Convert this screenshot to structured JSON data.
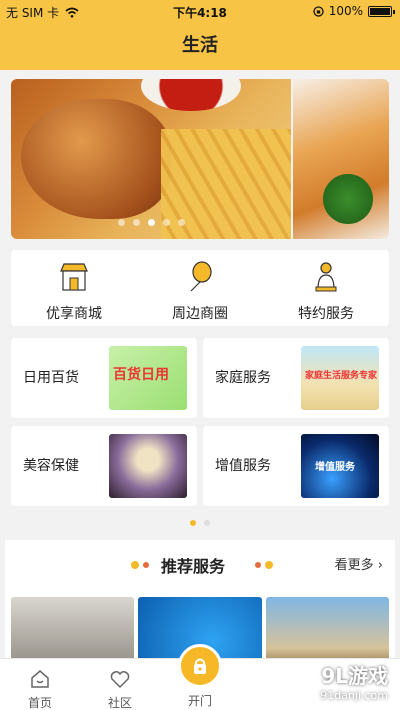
{
  "status_bar": {
    "carrier": "无 SIM 卡",
    "time": "下午4:18",
    "battery": "100%"
  },
  "nav": {
    "title": "生活"
  },
  "banner": {
    "slides": 5,
    "active_slide": 2
  },
  "categories": [
    {
      "label": "优享商城",
      "icon": "shop-icon"
    },
    {
      "label": "周边商圈",
      "icon": "balloon-icon"
    },
    {
      "label": "特约服务",
      "icon": "service-figure-icon"
    }
  ],
  "services": [
    {
      "label": "日用百货",
      "image_text": "百货日用"
    },
    {
      "label": "家庭服务",
      "image_text": "家庭生活服务专家"
    },
    {
      "label": "美容保健",
      "image_text": ""
    },
    {
      "label": "增值服务",
      "image_text": "增值服务"
    }
  ],
  "page_indicator": {
    "pages": 2,
    "active": 0
  },
  "recommend": {
    "title": "推荐服务",
    "more": "看更多"
  },
  "tabbar": [
    {
      "label": "首页",
      "icon": "home-icon"
    },
    {
      "label": "社区",
      "icon": "community-icon"
    },
    {
      "label": "开门",
      "icon": "open-door-icon"
    }
  ],
  "watermark": {
    "brand": "9L游戏",
    "url": "91danji.com"
  },
  "colors": {
    "accent": "#f7c445",
    "button": "#f6b826"
  }
}
